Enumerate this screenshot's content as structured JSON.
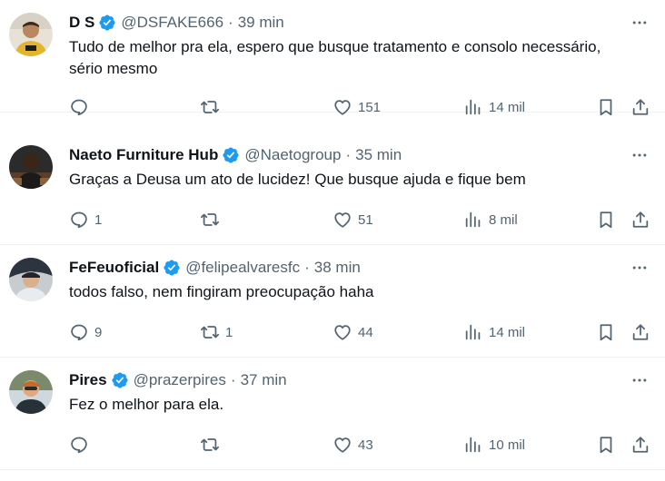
{
  "colors": {
    "text_primary": "#0f1419",
    "text_secondary": "#536471",
    "verified_badge": "#1d9bf0",
    "divider": "#eff3f4"
  },
  "icons": {
    "reply": "speech-bubble-icon",
    "retweet": "retweet-arrows-icon",
    "like": "heart-icon",
    "views": "bar-chart-icon",
    "bookmark": "bookmark-icon",
    "share": "upload-arrow-icon",
    "more": "three-dots-icon",
    "verified": "verified-checkmark-icon"
  },
  "tweets": [
    {
      "name": "D S",
      "handle": "@DSFAKE666",
      "separator": "·",
      "time": "39 min",
      "text": "Tudo de melhor pra ela, espero que busque tratamento e consolo necessário, sério mesmo",
      "replies": "",
      "retweets": "",
      "likes": "151",
      "views": "14 mil"
    },
    {
      "name": "Naeto Furniture Hub",
      "handle": "@Naetogroup",
      "separator": "·",
      "time": "35 min",
      "text": "Graças a Deusa um ato de lucidez! Que busque ajuda e fique bem",
      "replies": "1",
      "retweets": "",
      "likes": "51",
      "views": "8 mil"
    },
    {
      "name": "FeFeuoficial",
      "handle": "@felipealvaresfc",
      "separator": "·",
      "time": "38 min",
      "text": "todos falso, nem fingiram preocupação haha",
      "replies": "9",
      "retweets": "1",
      "likes": "44",
      "views": "14 mil"
    },
    {
      "name": "Pires",
      "handle": "@prazerpires",
      "separator": "·",
      "time": "37 min",
      "text": "Fez o melhor para ela.",
      "replies": "",
      "retweets": "",
      "likes": "43",
      "views": "10 mil"
    }
  ]
}
